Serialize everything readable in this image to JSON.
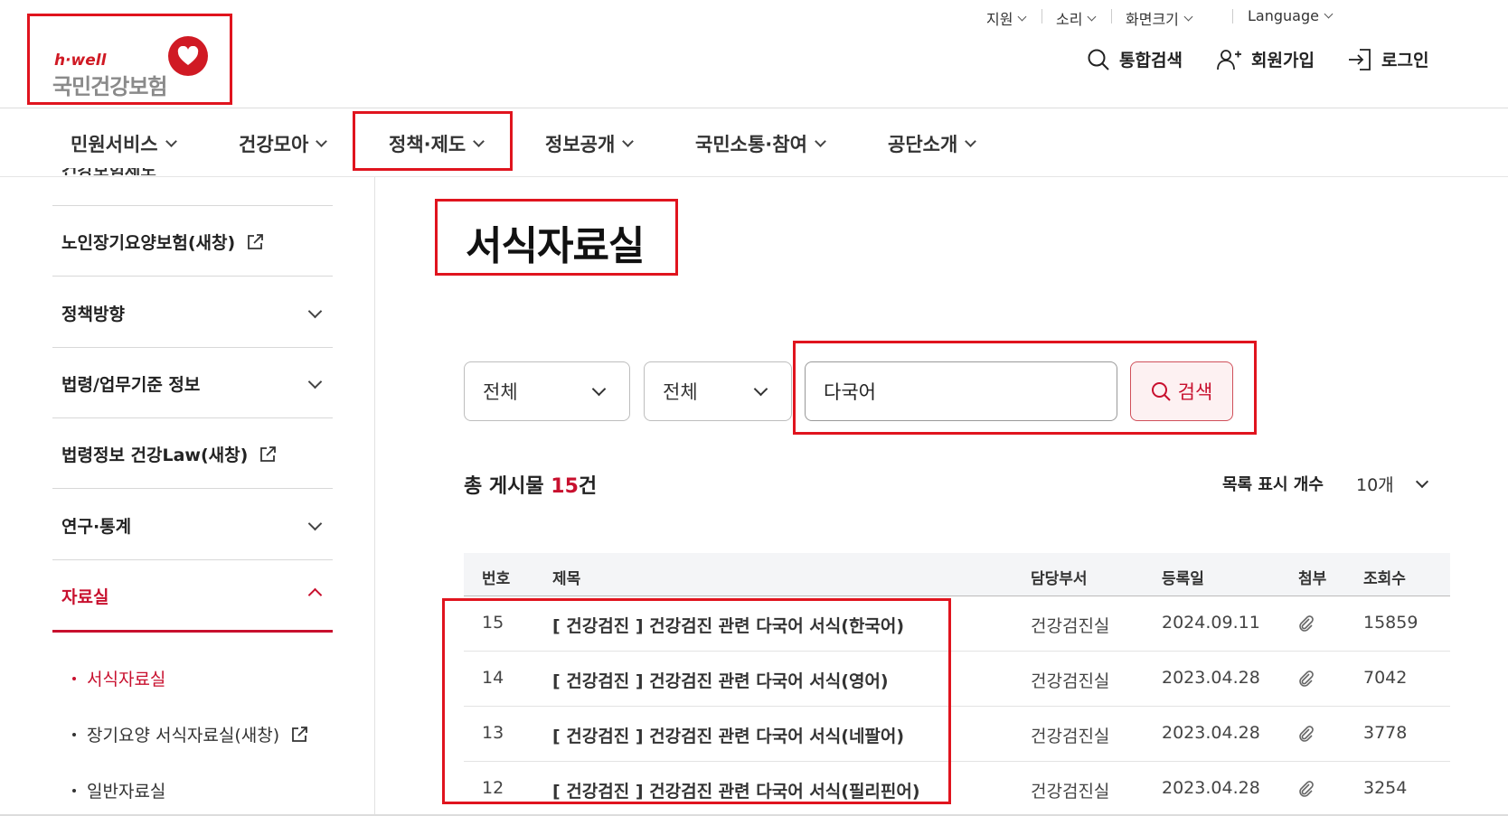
{
  "logo": {
    "brand": "h·well",
    "name": "국민건강보험"
  },
  "util_menu": [
    {
      "label": "지원"
    },
    {
      "label": "소리"
    },
    {
      "label": "화면크기"
    },
    {
      "label": "Language"
    }
  ],
  "header_buttons": {
    "search": "통합검색",
    "signup": "회원가입",
    "login": "로그인"
  },
  "gnb": [
    {
      "label": "민원서비스"
    },
    {
      "label": "건강모아"
    },
    {
      "label": "정책·제도"
    },
    {
      "label": "정보공개"
    },
    {
      "label": "국민소통·참여"
    },
    {
      "label": "공단소개"
    }
  ],
  "lnb": {
    "cut_item": "건강보험제도",
    "items": [
      {
        "label": "노인장기요양보험(새창)"
      },
      {
        "label": "정책방향"
      },
      {
        "label": "법령/업무기준 정보"
      },
      {
        "label": "법령정보 건강Law(새창)"
      },
      {
        "label": "연구·통계"
      },
      {
        "label": "자료실"
      }
    ],
    "sub_items": [
      {
        "label": "서식자료실"
      },
      {
        "label": "장기요양 서식자료실(새창)"
      },
      {
        "label": "일반자료실"
      }
    ]
  },
  "page": {
    "title": "서식자료실"
  },
  "search": {
    "select1": "전체",
    "select2": "전체",
    "keyword": "다국어",
    "button": "검색"
  },
  "summary": {
    "prefix": "총 게시물 ",
    "count": "15",
    "suffix": "건",
    "list_count_label": "목록 표시 개수",
    "list_count_value": "10개"
  },
  "table": {
    "headers": [
      "번호",
      "제목",
      "담당부서",
      "등록일",
      "첨부",
      "조회수"
    ],
    "rows": [
      {
        "no": "15",
        "title": "[ 건강검진 ] 건강검진 관련 다국어 서식(한국어)",
        "dept": "건강검진실",
        "date": "2024.09.11",
        "views": "15859"
      },
      {
        "no": "14",
        "title": "[ 건강검진 ] 건강검진 관련 다국어 서식(영어)",
        "dept": "건강검진실",
        "date": "2023.04.28",
        "views": "7042"
      },
      {
        "no": "13",
        "title": "[ 건강검진 ] 건강검진 관련 다국어 서식(네팔어)",
        "dept": "건강검진실",
        "date": "2023.04.28",
        "views": "3778"
      },
      {
        "no": "12",
        "title": "[ 건강검진 ] 건강검진 관련 다국어 서식(필리핀어)",
        "dept": "건강검진실",
        "date": "2023.04.28",
        "views": "3254"
      }
    ]
  },
  "colors": {
    "accent": "#c8102e",
    "highlight_box": "#e0141e"
  }
}
